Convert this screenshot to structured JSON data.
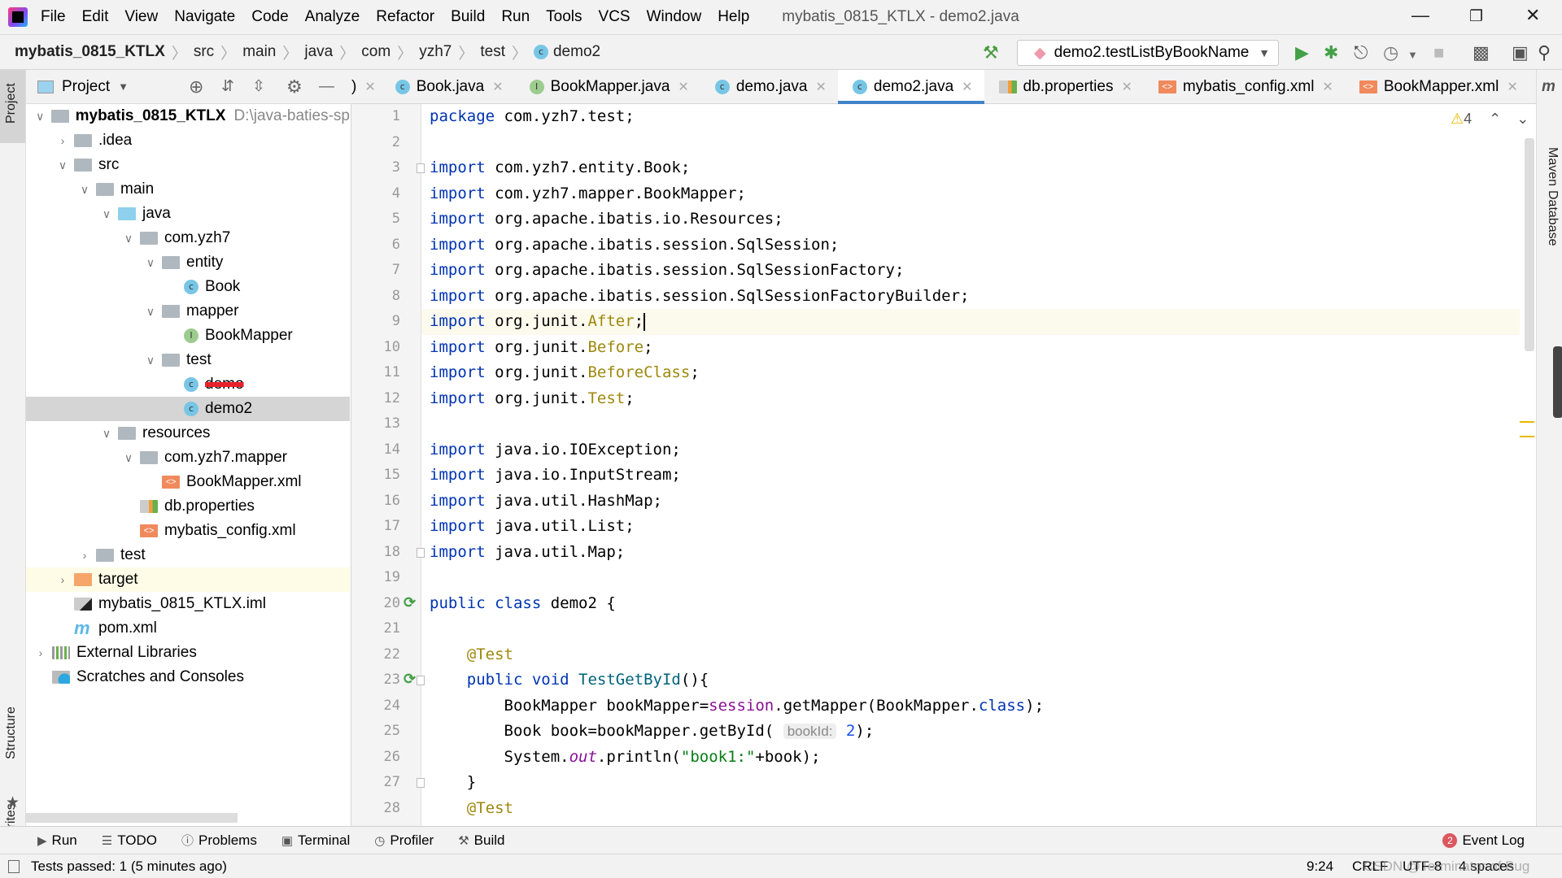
{
  "window": {
    "title": "mybatis_0815_KTLX - demo2.java"
  },
  "menu": [
    "File",
    "Edit",
    "View",
    "Navigate",
    "Code",
    "Analyze",
    "Refactor",
    "Build",
    "Run",
    "Tools",
    "VCS",
    "Window",
    "Help"
  ],
  "breadcrumb": [
    "mybatis_0815_KTLX",
    "src",
    "main",
    "java",
    "com",
    "yzh7",
    "test",
    "demo2"
  ],
  "run_config": "demo2.testListByBookName",
  "project_panel": {
    "title": "Project"
  },
  "tree": [
    {
      "label": "mybatis_0815_KTLX",
      "extra": "D:\\java-baties-sp",
      "depth": 0,
      "chev": "down",
      "icon": "module",
      "bold": true
    },
    {
      "label": ".idea",
      "depth": 1,
      "chev": "right",
      "icon": "folder"
    },
    {
      "label": "src",
      "depth": 1,
      "chev": "down",
      "icon": "folder"
    },
    {
      "label": "main",
      "depth": 2,
      "chev": "down",
      "icon": "folder"
    },
    {
      "label": "java",
      "depth": 3,
      "chev": "down",
      "icon": "folder-src"
    },
    {
      "label": "com.yzh7",
      "depth": 4,
      "chev": "down",
      "icon": "package"
    },
    {
      "label": "entity",
      "depth": 5,
      "chev": "down",
      "icon": "package"
    },
    {
      "label": "Book",
      "depth": 6,
      "icon": "class"
    },
    {
      "label": "mapper",
      "depth": 5,
      "chev": "down",
      "icon": "package"
    },
    {
      "label": "BookMapper",
      "depth": 6,
      "icon": "interface"
    },
    {
      "label": "test",
      "depth": 5,
      "chev": "down",
      "icon": "package"
    },
    {
      "label": "demo",
      "depth": 6,
      "icon": "class",
      "struck": true
    },
    {
      "label": "demo2",
      "depth": 6,
      "icon": "class",
      "selected": true
    },
    {
      "label": "resources",
      "depth": 3,
      "chev": "down",
      "icon": "folder-res"
    },
    {
      "label": "com.yzh7.mapper",
      "depth": 4,
      "chev": "down",
      "icon": "folder"
    },
    {
      "label": "BookMapper.xml",
      "depth": 5,
      "icon": "xml"
    },
    {
      "label": "db.properties",
      "depth": 4,
      "icon": "properties"
    },
    {
      "label": "mybatis_config.xml",
      "depth": 4,
      "icon": "xml"
    },
    {
      "label": "test",
      "depth": 2,
      "chev": "right",
      "icon": "folder"
    },
    {
      "label": "target",
      "depth": 1,
      "chev": "right",
      "icon": "folder-excluded",
      "highlight": true
    },
    {
      "label": "mybatis_0815_KTLX.iml",
      "depth": 1,
      "icon": "iml"
    },
    {
      "label": "pom.xml",
      "depth": 1,
      "icon": "maven"
    },
    {
      "label": "External Libraries",
      "depth": 0,
      "chev": "right",
      "icon": "libraries"
    },
    {
      "label": "Scratches and Consoles",
      "depth": 0,
      "icon": "scratches"
    }
  ],
  "tabs": [
    {
      "label": ")",
      "icon": "none"
    },
    {
      "label": "Book.java",
      "icon": "class"
    },
    {
      "label": "BookMapper.java",
      "icon": "interface"
    },
    {
      "label": "demo.java",
      "icon": "class"
    },
    {
      "label": "demo2.java",
      "icon": "class",
      "active": true
    },
    {
      "label": "db.properties",
      "icon": "properties"
    },
    {
      "label": "mybatis_config.xml",
      "icon": "xml"
    },
    {
      "label": "BookMapper.xml",
      "icon": "xml"
    }
  ],
  "editor": {
    "warnings": "4",
    "current_line": 9,
    "lines": [
      [
        [
          "package ",
          "kw"
        ],
        [
          "com.yzh7.test;",
          ""
        ]
      ],
      [],
      [
        [
          "import ",
          "kw"
        ],
        [
          "com.yzh7.entity.Book;",
          ""
        ]
      ],
      [
        [
          "import ",
          "kw"
        ],
        [
          "com.yzh7.mapper.BookMapper;",
          ""
        ]
      ],
      [
        [
          "import ",
          "kw"
        ],
        [
          "org.apache.ibatis.io.Resources;",
          ""
        ]
      ],
      [
        [
          "import ",
          "kw"
        ],
        [
          "org.apache.ibatis.session.SqlSession;",
          ""
        ]
      ],
      [
        [
          "import ",
          "kw"
        ],
        [
          "org.apache.ibatis.session.SqlSessionFactory;",
          ""
        ]
      ],
      [
        [
          "import ",
          "kw"
        ],
        [
          "org.apache.ibatis.session.SqlSessionFactoryBuilder;",
          ""
        ]
      ],
      [
        [
          "import ",
          "kw"
        ],
        [
          "org.junit.",
          ""
        ],
        [
          "After",
          "imp"
        ],
        [
          ";",
          ""
        ]
      ],
      [
        [
          "import ",
          "kw"
        ],
        [
          "org.junit.",
          ""
        ],
        [
          "Before",
          "imp"
        ],
        [
          ";",
          ""
        ]
      ],
      [
        [
          "import ",
          "kw"
        ],
        [
          "org.junit.",
          ""
        ],
        [
          "BeforeClass",
          "imp"
        ],
        [
          ";",
          ""
        ]
      ],
      [
        [
          "import ",
          "kw"
        ],
        [
          "org.junit.",
          ""
        ],
        [
          "Test",
          "imp"
        ],
        [
          ";",
          ""
        ]
      ],
      [],
      [
        [
          "import ",
          "kw"
        ],
        [
          "java.io.IOException;",
          ""
        ]
      ],
      [
        [
          "import ",
          "kw"
        ],
        [
          "java.io.InputStream;",
          ""
        ]
      ],
      [
        [
          "import ",
          "kw"
        ],
        [
          "java.util.HashMap;",
          ""
        ]
      ],
      [
        [
          "import ",
          "kw"
        ],
        [
          "java.util.List;",
          ""
        ]
      ],
      [
        [
          "import ",
          "kw"
        ],
        [
          "java.util.Map;",
          ""
        ]
      ],
      [],
      [
        [
          "public class ",
          "kw"
        ],
        [
          "demo2 {",
          ""
        ]
      ],
      [],
      [
        [
          "    ",
          ""
        ],
        [
          "@Test",
          "an"
        ]
      ],
      [
        [
          "    ",
          ""
        ],
        [
          "public void ",
          "kw"
        ],
        [
          "TestGetById",
          "fn"
        ],
        [
          "(){",
          ""
        ]
      ],
      [
        [
          "        BookMapper bookMapper=",
          ""
        ],
        [
          "session",
          "fld"
        ],
        [
          ".getMapper(BookMapper.",
          ""
        ],
        [
          "class",
          "kw"
        ],
        [
          ");",
          ""
        ]
      ],
      [
        [
          "        Book book=bookMapper.getById( ",
          ""
        ],
        [
          "bookId:",
          "hint"
        ],
        [
          " ",
          ""
        ],
        [
          "2",
          "num"
        ],
        [
          ");",
          ""
        ]
      ],
      [
        [
          "        System.",
          ""
        ],
        [
          "out",
          "it"
        ],
        [
          ".println(",
          ""
        ],
        [
          "\"book1:\"",
          "str"
        ],
        [
          "+book);",
          ""
        ]
      ],
      [
        [
          "    }",
          ""
        ]
      ],
      [
        [
          "    ",
          ""
        ],
        [
          "@Test",
          "an"
        ]
      ]
    ]
  },
  "right_tools": [
    "Maven",
    "Database"
  ],
  "left_tools": [
    "Project",
    "Structure",
    "Favorites"
  ],
  "bottom_tools": [
    {
      "label": "Run",
      "icon": "run-icon"
    },
    {
      "label": "TODO",
      "icon": "list-icon"
    },
    {
      "label": "Problems",
      "icon": "problems-icon"
    },
    {
      "label": "Terminal",
      "icon": "terminal-icon"
    },
    {
      "label": "Profiler",
      "icon": "profiler-icon"
    },
    {
      "label": "Build",
      "icon": "hammer-icon"
    }
  ],
  "event_log": {
    "label": "Event Log",
    "count": "2"
  },
  "status": {
    "message": "Tests passed: 1 (5 minutes ago)",
    "position": "9:24",
    "line_sep": "CRLF",
    "encoding": "UTF-8",
    "indent": "4 spaces",
    "watermark": "CSDN @Terminator of Bug"
  },
  "colors": {
    "accent": "#4083c9",
    "keyword": "#0033b3",
    "annotation": "#9e880d",
    "string": "#067d17",
    "number": "#1750eb",
    "field": "#871094",
    "method": "#00627a"
  }
}
